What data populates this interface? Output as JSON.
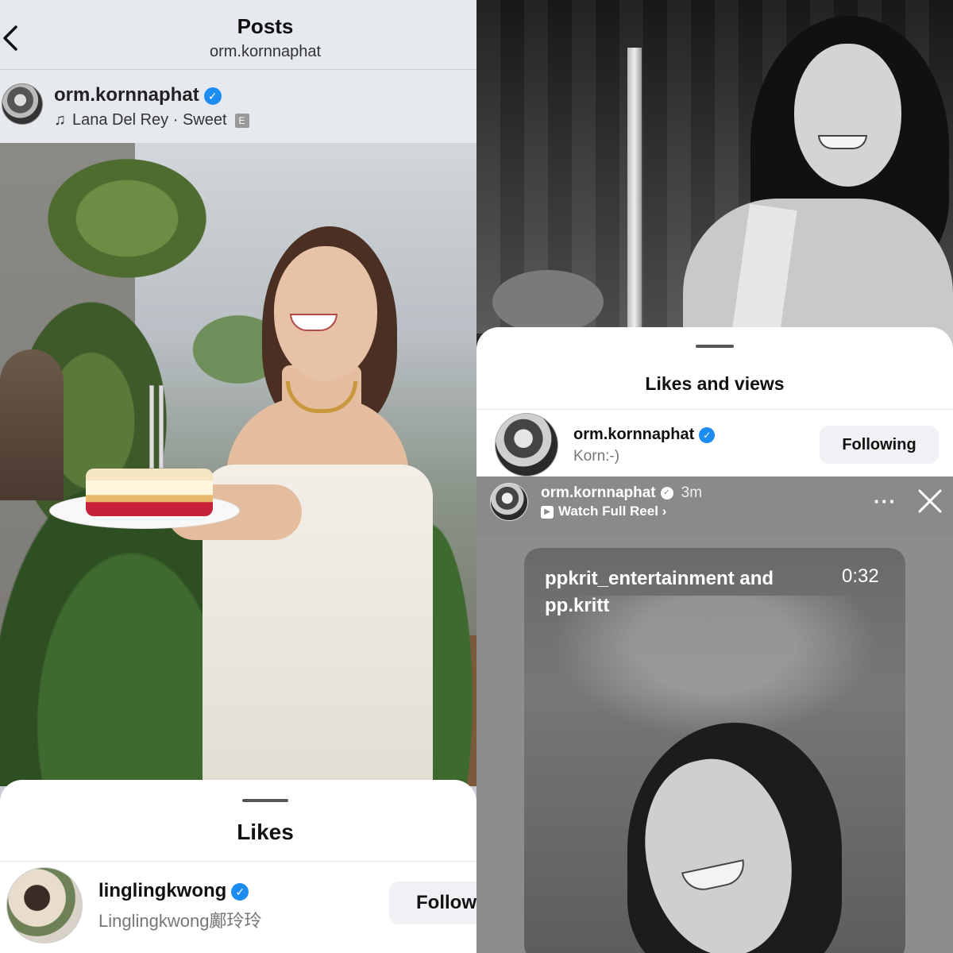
{
  "left": {
    "header": {
      "title": "Posts",
      "subtitle": "orm.kornnaphat"
    },
    "post": {
      "username": "orm.kornnaphat",
      "music": "Lana Del Rey · Sweet",
      "explicit_badge": "E"
    },
    "likes_sheet": {
      "title": "Likes",
      "user": {
        "username": "linglingkwong",
        "display_name": "Linglingkwong鄺玲玲",
        "follow_label": "Follow"
      }
    }
  },
  "right": {
    "views_sheet": {
      "title": "Likes and views",
      "user": {
        "username": "orm.kornnaphat",
        "display_name": "Korn:-)",
        "following_label": "Following"
      }
    },
    "story": {
      "username": "orm.kornnaphat",
      "time": "3m",
      "watch_label": "Watch Full Reel",
      "more_label": "···",
      "reel": {
        "credit": "ppkrit_entertainment and pp.kritt",
        "duration": "0:32"
      }
    }
  },
  "colors": {
    "verified_blue": "#1d8cf0",
    "button_bg": "#eff1f4"
  },
  "icons": {
    "back": "chevron-left-icon",
    "verified": "verified-badge-icon",
    "music": "music-note-icon",
    "close": "close-icon",
    "more": "more-horizontal-icon",
    "play": "play-icon"
  }
}
